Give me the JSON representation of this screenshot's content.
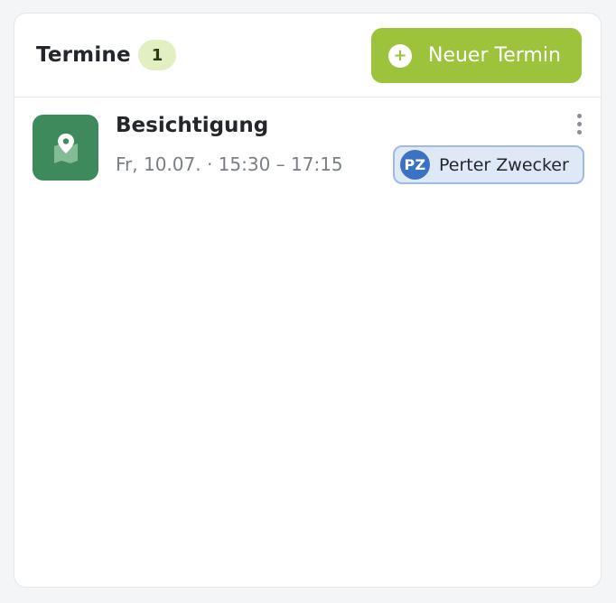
{
  "header": {
    "title": "Termine",
    "count": "1",
    "new_button_label": "Neuer Termin",
    "new_button_icon": "plus-circle-icon"
  },
  "appointments": [
    {
      "title": "Besichtigung",
      "time": "Fr, 10.07. · 15:30 – 17:15",
      "icon": "map-pin-icon",
      "assignee": {
        "initials": "PZ",
        "name": "Perter Zwecker"
      }
    }
  ],
  "colors": {
    "accent": "#9dc23c",
    "badge_bg": "#e2efc3",
    "appointment_icon_bg": "#3e8a5c",
    "assignee_chip_bg": "#dfe8f6",
    "avatar_bg": "#3c72c4"
  }
}
